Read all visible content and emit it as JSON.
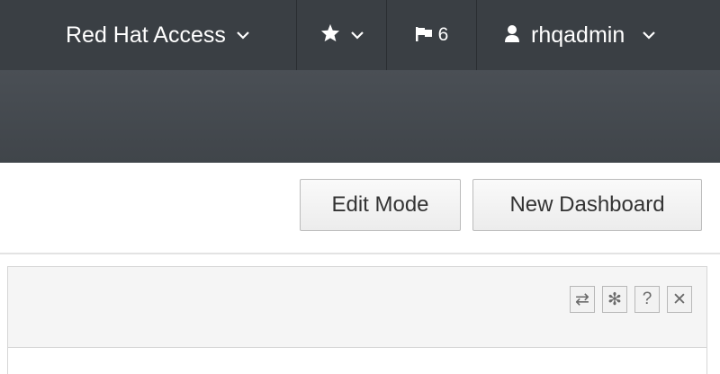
{
  "topnav": {
    "access_label": "Red Hat Access",
    "alerts_count": "6",
    "user_label": "rhqadmin"
  },
  "toolbar": {
    "edit_mode_label": "Edit Mode",
    "new_dashboard_label": "New Dashboard"
  },
  "panel": {
    "icons": {
      "refresh": "⇄",
      "settings": "✻",
      "help": "?",
      "close": "✕"
    }
  },
  "colors": {
    "topbar_bg": "#3a3f44",
    "subbar_bg": "#45494e"
  }
}
